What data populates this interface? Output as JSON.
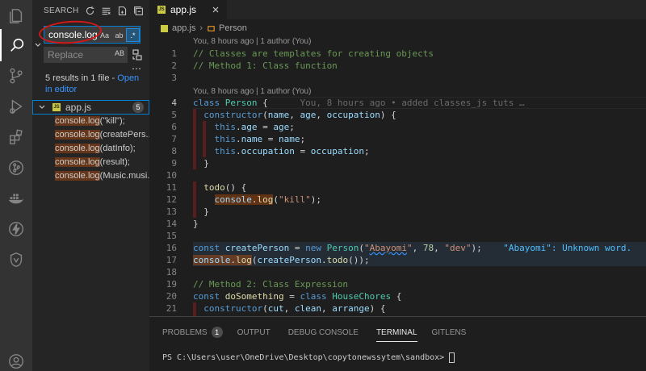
{
  "sidebar": {
    "title": "SEARCH",
    "search_value": "console.log",
    "opt_case": "Aa",
    "opt_word": "ab",
    "opt_regex": ".*",
    "replace_placeholder": "Replace",
    "replace_ab": "AB",
    "summary_text": "5 results in 1 file - ",
    "summary_link": "Open in editor",
    "file": {
      "name": "app.js",
      "count": "5",
      "badge": "JS"
    },
    "matches": [
      {
        "hit": "console.log",
        "rest": "(\"kill\");"
      },
      {
        "hit": "console.log",
        "rest": "(createPers..."
      },
      {
        "hit": "console.log",
        "rest": "(datInfo);"
      },
      {
        "hit": "console.log",
        "rest": "(result);"
      },
      {
        "hit": "console.log",
        "rest": "(Music.musi..."
      }
    ]
  },
  "editor": {
    "tab_name": "app.js",
    "breadcrumb": [
      "app.js",
      "Person"
    ],
    "codelens_1": "You, 8 hours ago | 1 author (You)",
    "codelens_2": "You, 8 hours ago | 1 author (You)",
    "blame_inline": "You, 8 hours ago • added classes_js tuts …",
    "diagnostic": "\"Abayomi\": Unknown word.",
    "line_numbers": [
      "1",
      "2",
      "3",
      "4",
      "5",
      "6",
      "7",
      "8",
      "9",
      "10",
      "11",
      "12",
      "13",
      "14",
      "15",
      "16",
      "17",
      "18",
      "19",
      "20",
      "21"
    ],
    "current_line": "4"
  },
  "panel": {
    "tabs": [
      "PROBLEMS",
      "OUTPUT",
      "DEBUG CONSOLE",
      "TERMINAL",
      "GITLENS"
    ],
    "problems_count": "1",
    "active_tab": "TERMINAL",
    "prompt": "PS C:\\Users\\user\\OneDrive\\Desktop\\copytonewssytem\\sandbox>"
  },
  "colors": {
    "accent": "#007fd4",
    "annotation_circle": "#d11818",
    "match_highlight": "#ea5c00"
  },
  "icons": [
    "files-icon",
    "search-icon",
    "source-control-icon",
    "run-debug-icon",
    "extensions-icon",
    "git-graph-icon",
    "docker-icon",
    "thunder-icon",
    "shield-icon",
    "account-icon"
  ]
}
